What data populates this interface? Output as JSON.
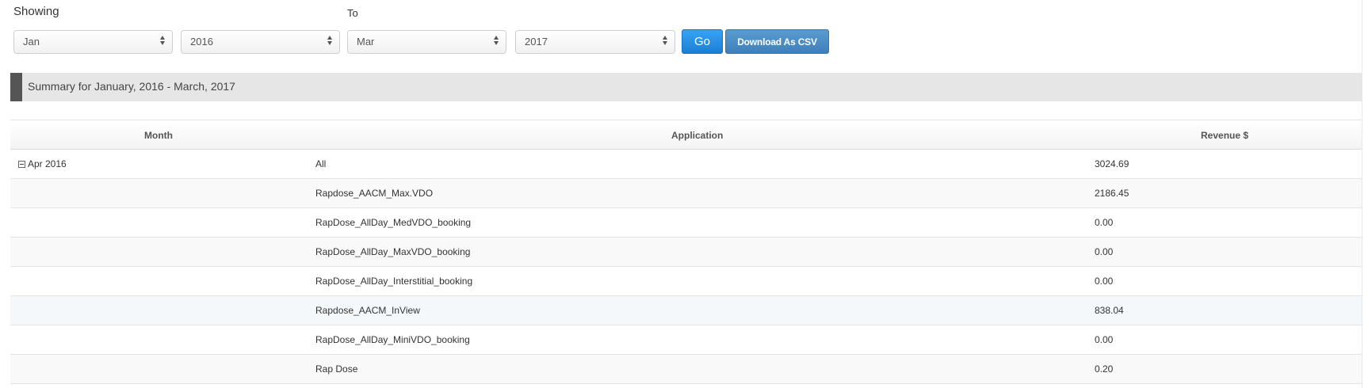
{
  "filters": {
    "showing_label": "Showing",
    "to_label": "To",
    "from_month": "Jan",
    "from_year": "2016",
    "to_month": "Mar",
    "to_year": "2017",
    "go_label": "Go",
    "download_label": "Download As CSV"
  },
  "summary": {
    "title": "Summary for January, 2016 - March, 2017"
  },
  "table": {
    "headers": {
      "month": "Month",
      "application": "Application",
      "revenue": "Revenue $"
    },
    "rows": [
      {
        "month": "Apr 2016",
        "application": "All",
        "revenue": "3024.69"
      },
      {
        "month": "",
        "application": "Rapdose_AACM_Max.VDO",
        "revenue": "2186.45"
      },
      {
        "month": "",
        "application": "RapDose_AllDay_MedVDO_booking",
        "revenue": "0.00"
      },
      {
        "month": "",
        "application": "RapDose_AllDay_MaxVDO_booking",
        "revenue": "0.00"
      },
      {
        "month": "",
        "application": "RapDose_AllDay_Interstitial_booking",
        "revenue": "0.00"
      },
      {
        "month": "",
        "application": "Rapdose_AACM_InView",
        "revenue": "838.04"
      },
      {
        "month": "",
        "application": "RapDose_AllDay_MiniVDO_booking",
        "revenue": "0.00"
      },
      {
        "month": "",
        "application": "Rap Dose",
        "revenue": "0.20"
      }
    ]
  },
  "colors": {
    "go_button": "#1a7fd4",
    "csv_button": "#3f80bb",
    "summary_bar": "#e6e6e6",
    "summary_accent": "#555555"
  },
  "icons": {
    "select_arrows": "updown-arrows-icon",
    "row_toggle": "collapse-minus-icon"
  }
}
